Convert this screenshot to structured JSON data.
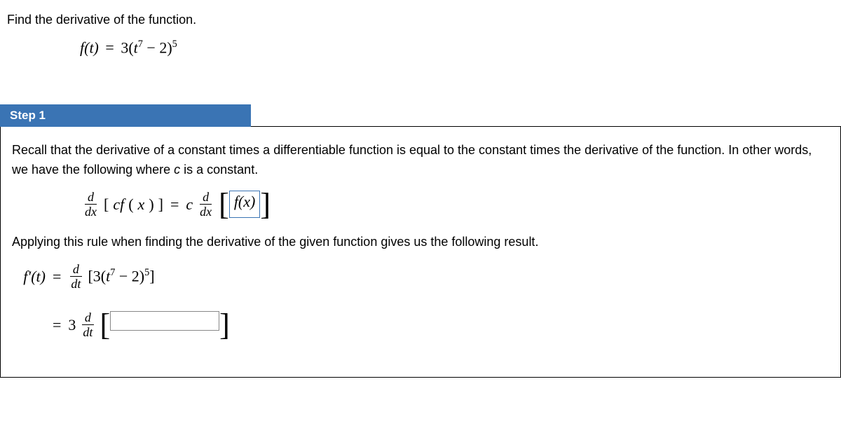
{
  "problem": {
    "title": "Find the derivative of the function.",
    "function_lhs": "f(t)",
    "equals": "=",
    "function_rhs_coeff": "3(",
    "function_rhs_base": "t",
    "function_rhs_exp1": "7",
    "function_rhs_mid": " − 2)",
    "function_rhs_exp2": "5"
  },
  "step": {
    "label": "Step 1"
  },
  "content": {
    "intro_part1": "Recall that the derivative of a constant times a differentiable function is equal to the constant times the derivative of the function. In other words, we have the following where ",
    "intro_c": "c",
    "intro_part2": " is a constant.",
    "rule": {
      "ddx_num": "d",
      "ddx_den": "dx",
      "lbr": "[",
      "cf": "cf",
      "x_open": "(",
      "x": "x",
      "x_close": ")",
      "rbr": "]",
      "c": "c",
      "fx": "f(x)"
    },
    "apply_text": "Applying this rule when finding the derivative of the given function gives us the following result.",
    "line1": {
      "lhs": "f′(t)",
      "ddt_num": "d",
      "ddt_den": "dt",
      "expr_open": "[3(",
      "t": "t",
      "exp1": "7",
      "mid": " − 2)",
      "exp2": "5",
      "close": "]"
    },
    "line2": {
      "coeff": "3",
      "ddt_num": "d",
      "ddt_den": "dt",
      "input_value": ""
    }
  }
}
